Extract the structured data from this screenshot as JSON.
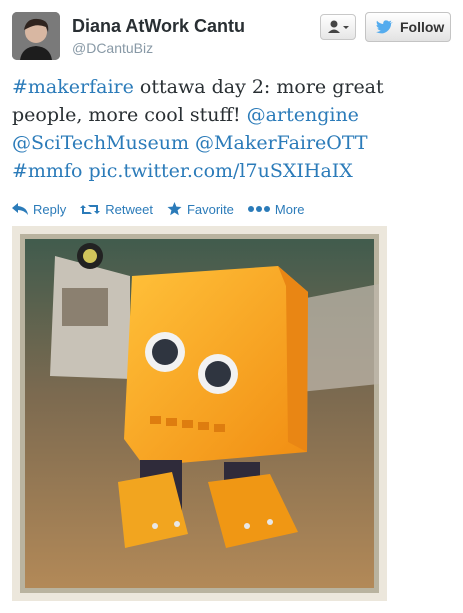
{
  "tweet": {
    "author_name": "Diana AtWork Cantu",
    "author_handle": "@DCantuBiz",
    "follow_label": "Follow",
    "text_segments": [
      {
        "text": "#makerfaire",
        "type": "hashtag"
      },
      {
        "text": " ottawa day 2: more great people, more cool stuff! ",
        "type": "text"
      },
      {
        "text": "@artengine",
        "type": "mention"
      },
      {
        "text": " ",
        "type": "text"
      },
      {
        "text": "@SciTechMuseum",
        "type": "mention"
      },
      {
        "text": " ",
        "type": "text"
      },
      {
        "text": "@MakerFaireOTT",
        "type": "mention"
      },
      {
        "text": " ",
        "type": "text"
      },
      {
        "text": "#mmfo",
        "type": "hashtag"
      },
      {
        "text": " ",
        "type": "text"
      },
      {
        "text": "pic.twitter.com/l7uSXIHaIX",
        "type": "link"
      }
    ]
  },
  "actions": {
    "reply": "Reply",
    "retweet": "Retweet",
    "favorite": "Favorite",
    "more": "More"
  },
  "colors": {
    "link": "#2b7bb9",
    "text": "#292f33",
    "handle": "#8899a6"
  },
  "icons": [
    "user-dropdown-icon",
    "twitter-bird-icon",
    "reply-icon",
    "retweet-icon",
    "star-icon",
    "more-dots-icon"
  ]
}
